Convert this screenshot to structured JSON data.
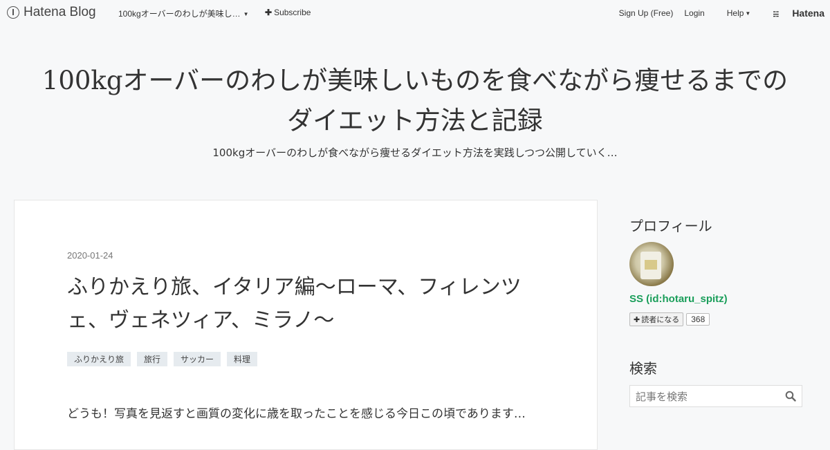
{
  "topbar": {
    "brand": "Hatena Blog",
    "blog_name": "100kgオーバーのわしが美味し…",
    "subscribe": "Subscribe",
    "signup": "Sign Up (Free)",
    "login": "Login",
    "help": "Help",
    "hatena": "Hatena"
  },
  "header": {
    "title_line1": "100kgオーバーのわしが美味しいものを食べながら痩せるまでの",
    "title_line2": "ダイエット方法と記録",
    "description": "100kgオーバーのわしが食べながら痩せるダイエット方法を実践しつつ公開していく…"
  },
  "article": {
    "date": "2020-01-24",
    "title": "ふりかえり旅、イタリア編〜ローマ、フィレンツェ、ヴェネツィア、ミラノ〜",
    "categories": [
      "ふりかえり旅",
      "旅行",
      "サッカー",
      "料理"
    ],
    "body": "どうも！写真を見返すと画質の変化に歳を取ったことを感じる今日この頃であります…"
  },
  "sidebar": {
    "profile_heading": "プロフィール",
    "profile_name": "SS (id:hotaru_spitz)",
    "subscribe_label": "読者になる",
    "subscriber_count": "368",
    "search_heading": "検索",
    "search_placeholder": "記事を検索"
  },
  "colors": {
    "background": "#f7f8f9",
    "profile_name": "#1a9e5a",
    "category_bg": "#e6ebef"
  }
}
